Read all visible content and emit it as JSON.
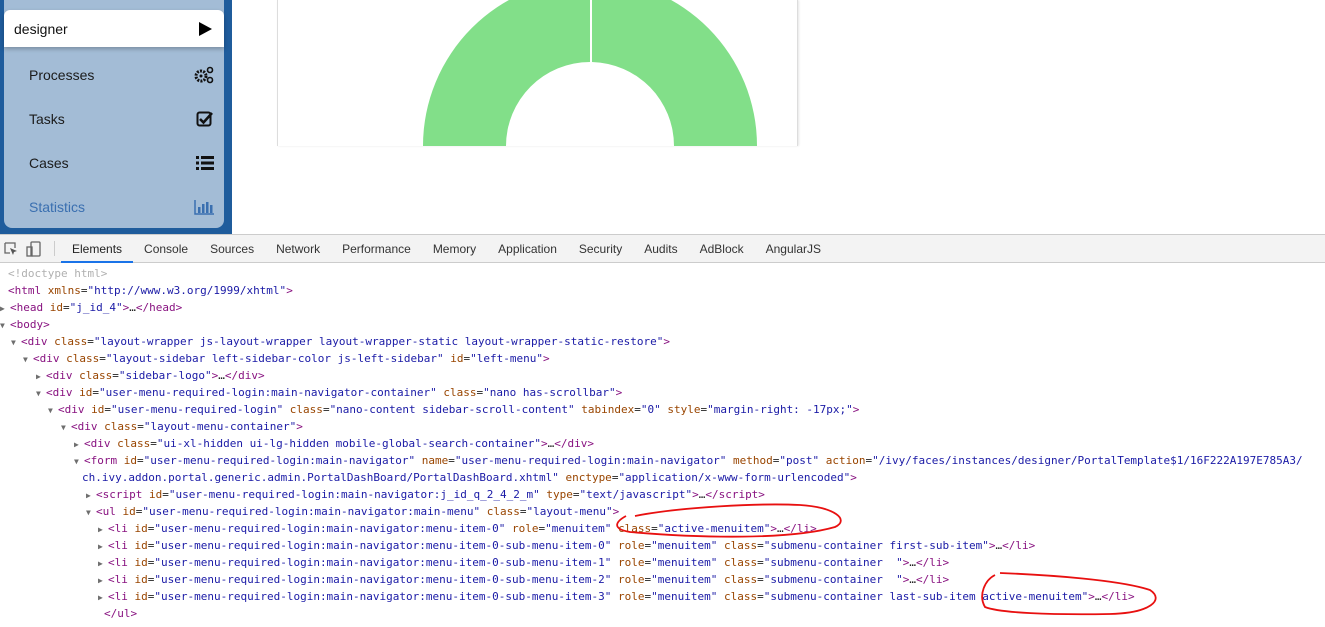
{
  "sidebar": {
    "user": "designer",
    "items": [
      {
        "label": "Processes",
        "icon": "gears-icon"
      },
      {
        "label": "Tasks",
        "icon": "check-square-icon"
      },
      {
        "label": "Cases",
        "icon": "list-icon"
      },
      {
        "label": "Statistics",
        "icon": "bar-chart-icon",
        "active": true
      }
    ],
    "active_color": "#3a6fb0"
  },
  "chart": {
    "type": "donut",
    "color": "#82df89",
    "segments": 2
  },
  "devtools": {
    "tabs": [
      "Elements",
      "Console",
      "Sources",
      "Network",
      "Performance",
      "Memory",
      "Application",
      "Security",
      "Audits",
      "AdBlock",
      "AngularJS"
    ],
    "active_tab": "Elements",
    "lines": [
      {
        "i": 8,
        "tri": "",
        "tk": [
          [
            "d",
            "<!doctype html>"
          ]
        ]
      },
      {
        "i": 8,
        "tri": "",
        "tk": [
          [
            "t",
            "<html "
          ],
          [
            "a",
            "xmlns"
          ],
          [
            "x",
            "="
          ],
          [
            "v",
            "\"http://www.w3.org/1999/xhtml\""
          ],
          [
            "t",
            ">"
          ]
        ]
      },
      {
        "i": 8,
        "tri": "▶",
        "tk": [
          [
            "t",
            "<head "
          ],
          [
            "a",
            "id"
          ],
          [
            "x",
            "="
          ],
          [
            "v",
            "\"j_id_4\""
          ],
          [
            "t",
            ">"
          ],
          [
            "x",
            "…"
          ],
          [
            "t",
            "</head>"
          ]
        ]
      },
      {
        "i": 8,
        "tri": "▼",
        "tk": [
          [
            "t",
            "<body>"
          ]
        ]
      },
      {
        "i": 21,
        "tri": "▼",
        "tk": [
          [
            "t",
            "<div "
          ],
          [
            "a",
            "class"
          ],
          [
            "x",
            "="
          ],
          [
            "v",
            "\"layout-wrapper js-layout-wrapper layout-wrapper-static layout-wrapper-static-restore\""
          ],
          [
            "t",
            ">"
          ]
        ]
      },
      {
        "i": 33,
        "tri": "▼",
        "tk": [
          [
            "t",
            "<div "
          ],
          [
            "a",
            "class"
          ],
          [
            "x",
            "="
          ],
          [
            "v",
            "\"layout-sidebar left-sidebar-color js-left-sidebar\""
          ],
          [
            "a",
            " id"
          ],
          [
            "x",
            "="
          ],
          [
            "v",
            "\"left-menu\""
          ],
          [
            "t",
            ">"
          ]
        ]
      },
      {
        "i": 46,
        "tri": "▶",
        "tk": [
          [
            "t",
            "<div "
          ],
          [
            "a",
            "class"
          ],
          [
            "x",
            "="
          ],
          [
            "v",
            "\"sidebar-logo\""
          ],
          [
            "t",
            ">"
          ],
          [
            "x",
            "…"
          ],
          [
            "t",
            "</div>"
          ]
        ]
      },
      {
        "i": 46,
        "tri": "▼",
        "tk": [
          [
            "t",
            "<div "
          ],
          [
            "a",
            "id"
          ],
          [
            "x",
            "="
          ],
          [
            "v",
            "\"user-menu-required-login:main-navigator-container\""
          ],
          [
            "a",
            " class"
          ],
          [
            "x",
            "="
          ],
          [
            "v",
            "\"nano has-scrollbar\""
          ],
          [
            "t",
            ">"
          ]
        ]
      },
      {
        "i": 58,
        "tri": "▼",
        "tk": [
          [
            "t",
            "<div "
          ],
          [
            "a",
            "id"
          ],
          [
            "x",
            "="
          ],
          [
            "v",
            "\"user-menu-required-login\""
          ],
          [
            "a",
            " class"
          ],
          [
            "x",
            "="
          ],
          [
            "v",
            "\"nano-content sidebar-scroll-content\""
          ],
          [
            "a",
            " tabindex"
          ],
          [
            "x",
            "="
          ],
          [
            "v",
            "\"0\""
          ],
          [
            "a",
            " style"
          ],
          [
            "x",
            "="
          ],
          [
            "v",
            "\"margin-right: -17px;\""
          ],
          [
            "t",
            ">"
          ]
        ]
      },
      {
        "i": 71,
        "tri": "▼",
        "tk": [
          [
            "t",
            "<div "
          ],
          [
            "a",
            "class"
          ],
          [
            "x",
            "="
          ],
          [
            "v",
            "\"layout-menu-container\""
          ],
          [
            "t",
            ">"
          ]
        ]
      },
      {
        "i": 84,
        "tri": "▶",
        "tk": [
          [
            "t",
            "<div "
          ],
          [
            "a",
            "class"
          ],
          [
            "x",
            "="
          ],
          [
            "v",
            "\"ui-xl-hidden ui-lg-hidden mobile-global-search-container\""
          ],
          [
            "t",
            ">"
          ],
          [
            "x",
            "…"
          ],
          [
            "t",
            "</div>"
          ]
        ]
      },
      {
        "i": 84,
        "tri": "▼",
        "tk": [
          [
            "t",
            "<form "
          ],
          [
            "a",
            "id"
          ],
          [
            "x",
            "="
          ],
          [
            "v",
            "\"user-menu-required-login:main-navigator\""
          ],
          [
            "a",
            " name"
          ],
          [
            "x",
            "="
          ],
          [
            "v",
            "\"user-menu-required-login:main-navigator\""
          ],
          [
            "a",
            " method"
          ],
          [
            "x",
            "="
          ],
          [
            "v",
            "\"post\""
          ],
          [
            "a",
            " action"
          ],
          [
            "x",
            "="
          ],
          [
            "v",
            "\"/ivy/faces/instances/designer/PortalTemplate$1/16F222A197E785A3/"
          ]
        ]
      },
      {
        "i": 82,
        "tri": "",
        "tk": [
          [
            "v",
            "ch.ivy.addon.portal.generic.admin.PortalDashBoard/PortalDashBoard.xhtml\""
          ],
          [
            "a",
            " enctype"
          ],
          [
            "x",
            "="
          ],
          [
            "v",
            "\"application/x-www-form-urlencoded\""
          ],
          [
            "t",
            ">"
          ]
        ]
      },
      {
        "i": 96,
        "tri": "▶",
        "tk": [
          [
            "t",
            "<script "
          ],
          [
            "a",
            "id"
          ],
          [
            "x",
            "="
          ],
          [
            "v",
            "\"user-menu-required-login:main-navigator:j_id_q_2_4_2_m\""
          ],
          [
            "a",
            " type"
          ],
          [
            "x",
            "="
          ],
          [
            "v",
            "\"text/javascript\""
          ],
          [
            "t",
            ">"
          ],
          [
            "x",
            "…"
          ],
          [
            "t",
            "</script>"
          ]
        ]
      },
      {
        "i": 96,
        "tri": "▼",
        "tk": [
          [
            "t",
            "<ul "
          ],
          [
            "a",
            "id"
          ],
          [
            "x",
            "="
          ],
          [
            "v",
            "\"user-menu-required-login:main-navigator:main-menu\""
          ],
          [
            "a",
            " class"
          ],
          [
            "x",
            "="
          ],
          [
            "v",
            "\"layout-menu\""
          ],
          [
            "t",
            ">"
          ]
        ]
      },
      {
        "i": 108,
        "tri": "▶",
        "tk": [
          [
            "t",
            "<li "
          ],
          [
            "a",
            "id"
          ],
          [
            "x",
            "="
          ],
          [
            "v",
            "\"user-menu-required-login:main-navigator:menu-item-0\""
          ],
          [
            "a",
            " role"
          ],
          [
            "x",
            "="
          ],
          [
            "v",
            "\"menuitem\""
          ],
          [
            "a",
            " class"
          ],
          [
            "x",
            "="
          ],
          [
            "v",
            "\"active-menuitem\""
          ],
          [
            "t",
            ">"
          ],
          [
            "x",
            "…"
          ],
          [
            "t",
            "</li>"
          ]
        ]
      },
      {
        "i": 108,
        "tri": "▶",
        "tk": [
          [
            "t",
            "<li "
          ],
          [
            "a",
            "id"
          ],
          [
            "x",
            "="
          ],
          [
            "v",
            "\"user-menu-required-login:main-navigator:menu-item-0-sub-menu-item-0\""
          ],
          [
            "a",
            " role"
          ],
          [
            "x",
            "="
          ],
          [
            "v",
            "\"menuitem\""
          ],
          [
            "a",
            " class"
          ],
          [
            "x",
            "="
          ],
          [
            "v",
            "\"submenu-container first-sub-item\""
          ],
          [
            "t",
            ">"
          ],
          [
            "x",
            "…"
          ],
          [
            "t",
            "</li>"
          ]
        ]
      },
      {
        "i": 108,
        "tri": "▶",
        "tk": [
          [
            "t",
            "<li "
          ],
          [
            "a",
            "id"
          ],
          [
            "x",
            "="
          ],
          [
            "v",
            "\"user-menu-required-login:main-navigator:menu-item-0-sub-menu-item-1\""
          ],
          [
            "a",
            " role"
          ],
          [
            "x",
            "="
          ],
          [
            "v",
            "\"menuitem\""
          ],
          [
            "a",
            " class"
          ],
          [
            "x",
            "="
          ],
          [
            "v",
            "\"submenu-container  \""
          ],
          [
            "t",
            ">"
          ],
          [
            "x",
            "…"
          ],
          [
            "t",
            "</li>"
          ]
        ]
      },
      {
        "i": 108,
        "tri": "▶",
        "tk": [
          [
            "t",
            "<li "
          ],
          [
            "a",
            "id"
          ],
          [
            "x",
            "="
          ],
          [
            "v",
            "\"user-menu-required-login:main-navigator:menu-item-0-sub-menu-item-2\""
          ],
          [
            "a",
            " role"
          ],
          [
            "x",
            "="
          ],
          [
            "v",
            "\"menuitem\""
          ],
          [
            "a",
            " class"
          ],
          [
            "x",
            "="
          ],
          [
            "v",
            "\"submenu-container  \""
          ],
          [
            "t",
            ">"
          ],
          [
            "x",
            "…"
          ],
          [
            "t",
            "</li>"
          ]
        ]
      },
      {
        "i": 108,
        "tri": "▶",
        "tk": [
          [
            "t",
            "<li "
          ],
          [
            "a",
            "id"
          ],
          [
            "x",
            "="
          ],
          [
            "v",
            "\"user-menu-required-login:main-navigator:menu-item-0-sub-menu-item-3\""
          ],
          [
            "a",
            " role"
          ],
          [
            "x",
            "="
          ],
          [
            "v",
            "\"menuitem\""
          ],
          [
            "a",
            " class"
          ],
          [
            "x",
            "="
          ],
          [
            "v",
            "\"submenu-container last-sub-item active-menuitem\""
          ],
          [
            "t",
            ">"
          ],
          [
            "x",
            "…"
          ],
          [
            "t",
            "</li>"
          ]
        ]
      },
      {
        "i": 104,
        "tri": "",
        "tk": [
          [
            "t",
            "</ul>"
          ]
        ]
      }
    ]
  }
}
